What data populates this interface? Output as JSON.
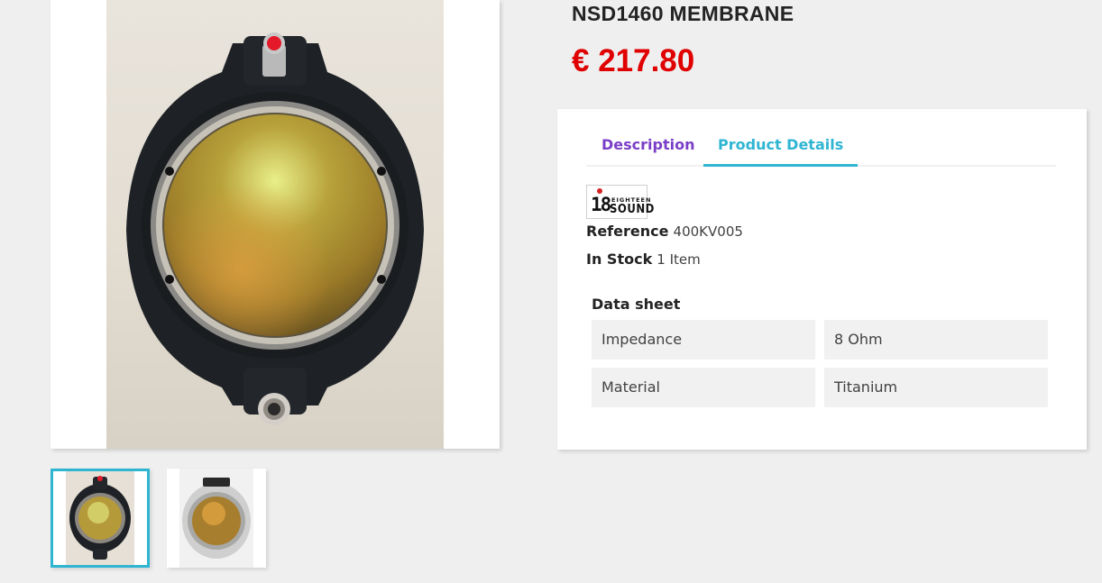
{
  "product": {
    "title": "NSD1460 MEMBRANE",
    "price": "€ 217.80"
  },
  "gallery": {
    "main_alt": "NSD1460 membrane front",
    "thumbnails": [
      {
        "alt": "membrane front view",
        "selected": true
      },
      {
        "alt": "membrane alternate view",
        "selected": false
      }
    ]
  },
  "tabs": {
    "items": [
      {
        "label": "Description",
        "active": false
      },
      {
        "label": "Product Details",
        "active": true
      }
    ]
  },
  "details": {
    "brand_logo": {
      "number": "18",
      "line1": "EIGHTEEN",
      "line2": "SOUND"
    },
    "reference_label": "Reference",
    "reference_value": "400KV005",
    "stock_label": "In Stock",
    "stock_value": "1 Item",
    "datasheet_title": "Data sheet",
    "datasheet": [
      {
        "name": "Impedance",
        "value": "8 Ohm"
      },
      {
        "name": "Material",
        "value": "Titanium"
      }
    ]
  },
  "colors": {
    "price": "#e00000",
    "accent": "#2fb5d2",
    "tab_inactive": "#7a3fc7"
  }
}
